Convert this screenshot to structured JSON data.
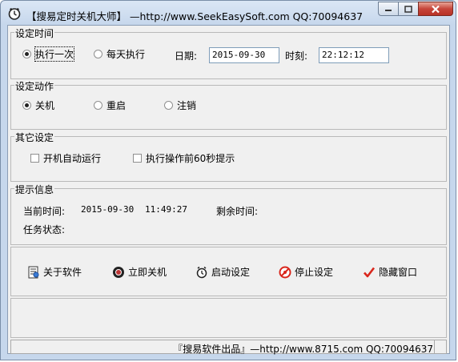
{
  "window": {
    "title": "【搜易定时关机大师】 —http://www.SeekEasySoft.com QQ:70094637",
    "icon": "clock-icon"
  },
  "time_group": {
    "title": "设定时间",
    "radio_once": "执行一次",
    "radio_daily": "每天执行",
    "selected": "once",
    "date_label": "日期:",
    "date_value": "2015-09-30",
    "time_label": "时刻:",
    "time_value": "22:12:12"
  },
  "action_group": {
    "title": "设定动作",
    "options": [
      "关机",
      "重启",
      "注销"
    ],
    "selected": "关机"
  },
  "other_group": {
    "title": "其它设定",
    "autostart_label": "开机自动运行",
    "autostart_checked": false,
    "warn_label": "执行操作前60秒提示",
    "warn_checked": false
  },
  "info_group": {
    "title": "提示信息",
    "current_time_label": "当前时间:",
    "current_date": "2015-09-30",
    "current_clock": "11:49:27",
    "remaining_label": "剩余时间:",
    "remaining_value": "",
    "task_status_label": "任务状态:",
    "task_status_value": ""
  },
  "buttons": {
    "about": "关于软件",
    "shutdown_now": "立即关机",
    "start": "启动设定",
    "stop": "停止设定",
    "hide": "隐藏窗口"
  },
  "statusbar": {
    "text": "『搜易软件出品』—http://www.8715.com QQ:70094637"
  },
  "colors": {
    "stop_icon": "#d9261c",
    "hide_check": "#d9261c"
  }
}
